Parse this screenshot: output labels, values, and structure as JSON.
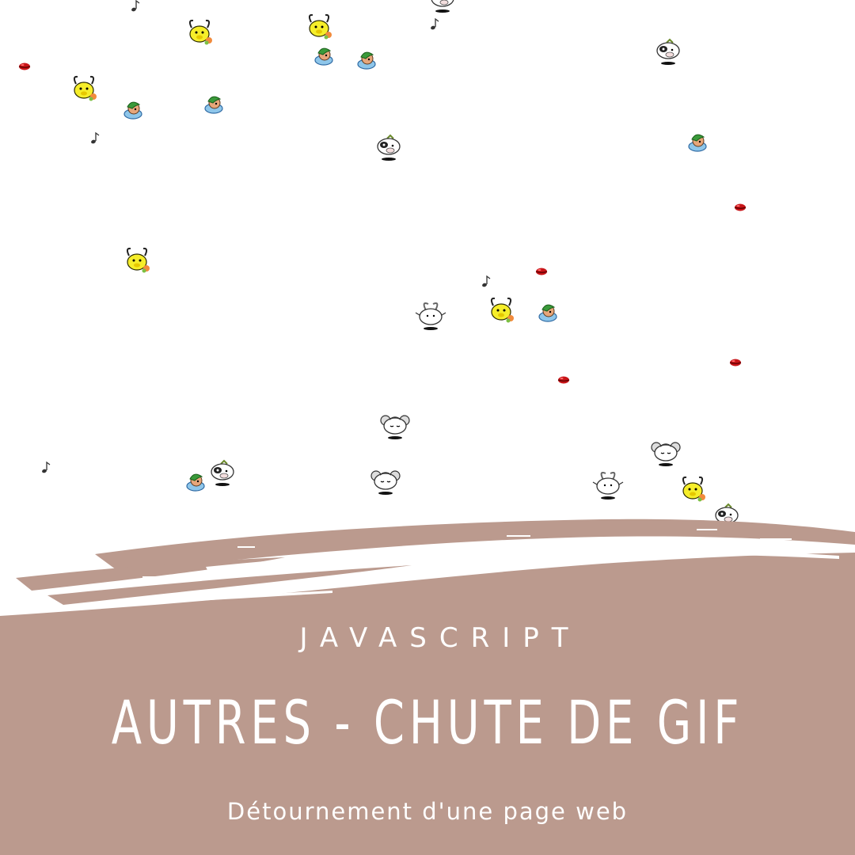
{
  "colors": {
    "background": "#ffffff",
    "brush": "#bb9a8e",
    "text": "#ffffff"
  },
  "banner": {
    "eyebrow": "JAVASCRIPT",
    "title": "AUTRES - CHUTE DE GIF",
    "subtitle": "Détournement d'une page web"
  },
  "sprite_types": [
    "kiss-lips-icon",
    "bull-icon",
    "bird-nest-icon",
    "cow-icon",
    "goat-icon",
    "sheep-icon",
    "music-note-icon"
  ]
}
